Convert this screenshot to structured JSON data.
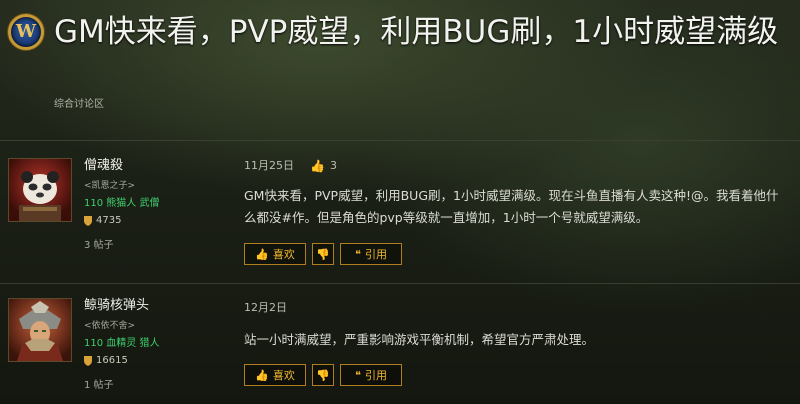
{
  "thread": {
    "title": "GM快来看，PVP威望，利用BUG刷，1小时威望满级",
    "forum": "综合讨论区",
    "logo_glyph": "W"
  },
  "posts": [
    {
      "author": "僧魂殺",
      "guild": "<凯恩之子>",
      "level": "110",
      "race_class": "熊猫人 武僧",
      "class_color": "#3fcf6f",
      "achievements": "4735",
      "post_count": "3 帖子",
      "date": "11月25日",
      "likes": "3",
      "text": "GM快来看，PVP威望，利用BUG刷，1小时威望满级。现在斗鱼直播有人卖这种!@。我看着他什么都没#作。但是角色的pvp等级就一直增加，1小时一个号就威望满级。",
      "buttons": {
        "like": "喜欢",
        "quote": "引用"
      }
    },
    {
      "author": "鲸骑核弹头",
      "guild": "<依依不舍>",
      "level": "110",
      "race_class": "血精灵 猎人",
      "class_color": "#3fcf6f",
      "achievements": "16615",
      "post_count": "1 帖子",
      "date": "12月2日",
      "text": "站一小时满威望，严重影响游戏平衡机制，希望官方严肃处理。",
      "buttons": {
        "like": "喜欢",
        "quote": "引用"
      }
    }
  ],
  "icons": {
    "thumb_up": "thumbs-up-icon",
    "thumb_down": "thumbs-down-icon",
    "quote": "quote-icon",
    "achievement": "shield-icon"
  },
  "colors": {
    "accent": "#f0b730",
    "button_border": "#b07e1f"
  }
}
